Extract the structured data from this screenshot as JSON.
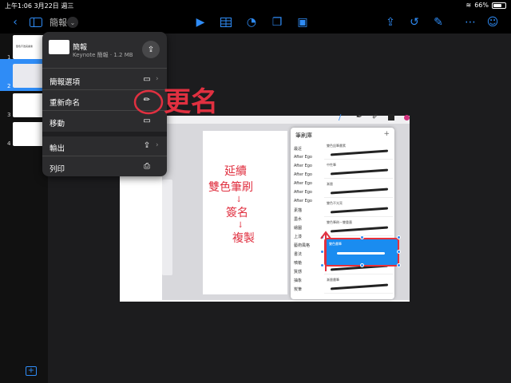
{
  "status": {
    "time": "上午1:06",
    "date": "3月22日 週三",
    "battery": "66%"
  },
  "toolbar": {
    "doc_title": "簡報",
    "accent": "#2f8cf6"
  },
  "sidebar": {
    "slides": [
      "1",
      "2",
      "3",
      "4"
    ],
    "slide1_text": "雙色不透亮畫素"
  },
  "popover": {
    "doc_name": "簡報",
    "doc_sub": "Keynote 簡報 · 1.2 MB",
    "items": [
      {
        "label": "簡報選項"
      },
      {
        "label": "重新命名"
      },
      {
        "label": "移動"
      },
      {
        "label": "輸出"
      },
      {
        "label": "列印"
      }
    ]
  },
  "annotation": {
    "rename_note": "更名",
    "handwriting": [
      "延續",
      "雙色筆刷",
      "↓",
      "簽名",
      "↓",
      "複製"
    ]
  },
  "brush_panel": {
    "title": "筆刷庫",
    "plus": "+",
    "categories": [
      "最近",
      "After Ego",
      "After Ego",
      "After Ego",
      "After Ego",
      "After Ego",
      "After Ego",
      "素描",
      "墨水",
      "繪圖",
      "上漆",
      "藝術風格",
      "書法",
      "噴槍",
      "質感",
      "抽象",
      "炭筆"
    ],
    "strokes": [
      "雙色鉛筆畫素",
      "中性筆",
      "漸層",
      "雙色不光亮",
      "雙色筆刷—雙重墨",
      "雙色畫筆",
      "",
      "漸層畫筆"
    ],
    "selected_stroke": "雙色畫筆"
  }
}
